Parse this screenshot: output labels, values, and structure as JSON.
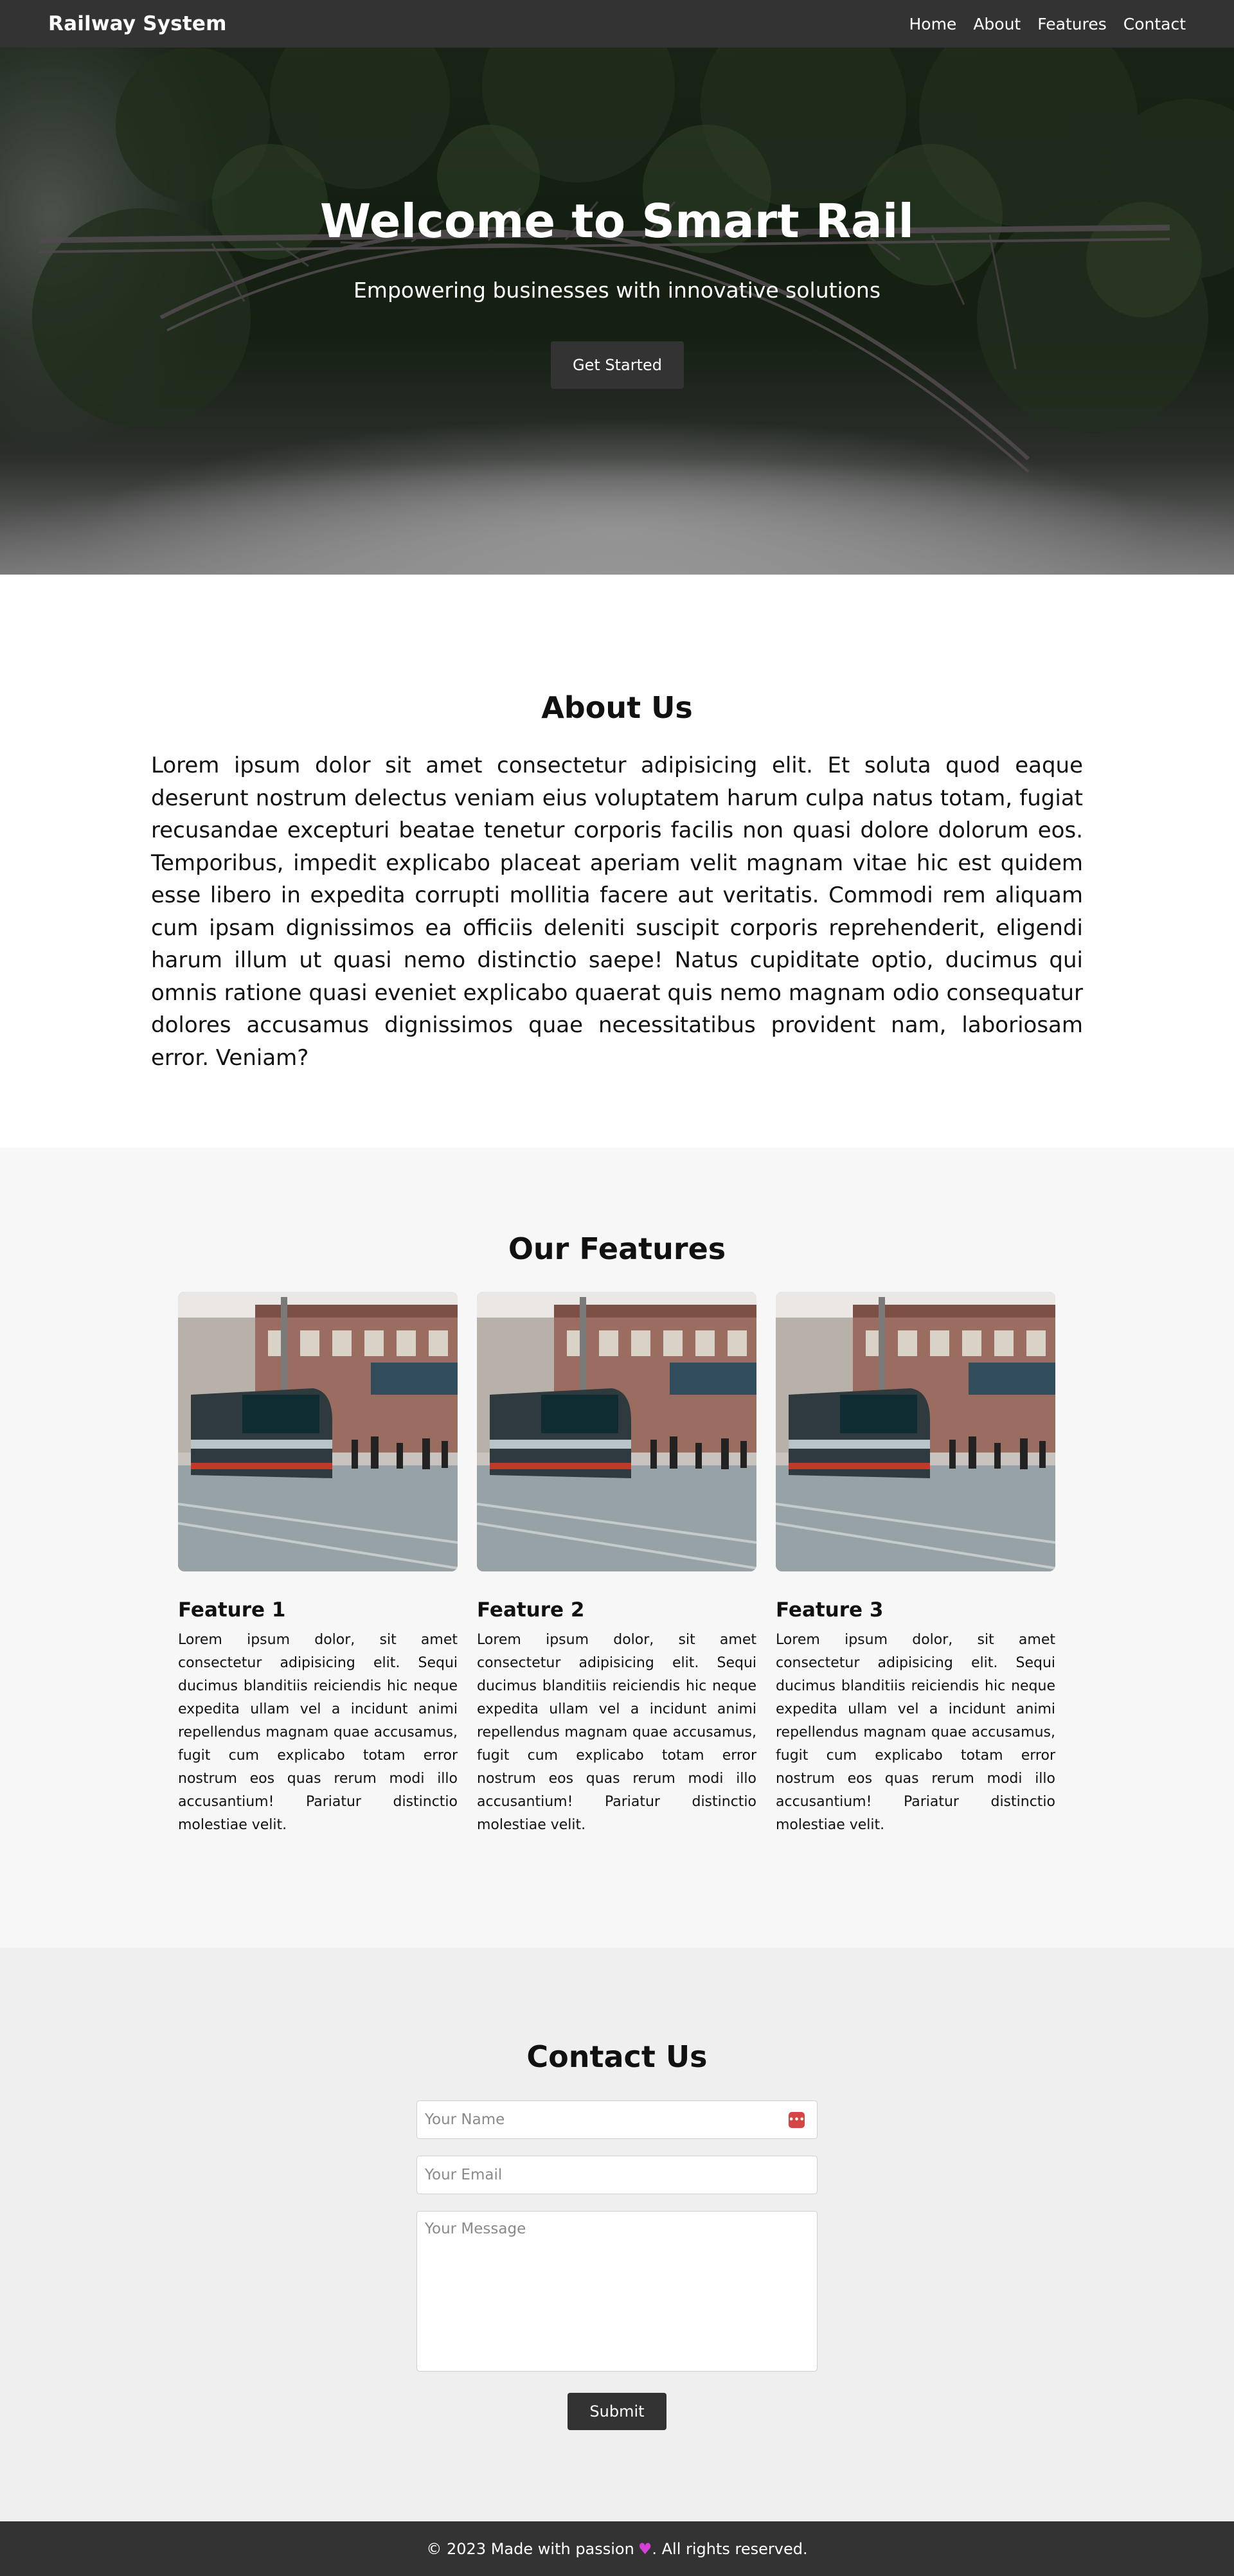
{
  "navbar": {
    "brand": "Railway System",
    "links": [
      "Home",
      "About",
      "Features",
      "Contact"
    ]
  },
  "hero": {
    "title": "Welcome to Smart Rail",
    "subtitle": "Empowering businesses with innovative solutions",
    "cta_label": "Get Started"
  },
  "about": {
    "title": "About Us",
    "text": "Lorem ipsum dolor sit amet consectetur adipisicing elit. Et soluta quod eaque deserunt nostrum delectus veniam eius voluptatem harum culpa natus totam, fugiat recusandae excepturi beatae tenetur corporis facilis non quasi dolore dolorum eos. Temporibus, impedit explicabo placeat aperiam velit magnam vitae hic est quidem esse libero in expedita corrupti mollitia facere aut veritatis. Commodi rem aliquam cum ipsam dignissimos ea officiis deleniti suscipit corporis reprehenderit, eligendi harum illum ut quasi nemo distinctio saepe! Natus cupiditate optio, ducimus qui omnis ratione quasi eveniet explicabo quaerat quis nemo magnam odio consequatur dolores accusamus dignissimos quae necessitatibus provident nam, laboriosam error. Veniam?"
  },
  "features": {
    "title": "Our Features",
    "items": [
      {
        "title": "Feature 1",
        "desc": "Lorem ipsum dolor, sit amet consectetur adipisicing elit. Sequi ducimus blanditiis reiciendis hic neque expedita ullam vel a incidunt animi repellendus magnam quae accusamus, fugit cum explicabo totam error nostrum eos quas rerum modi illo accusantium! Pariatur distinctio molestiae velit."
      },
      {
        "title": "Feature 2",
        "desc": "Lorem ipsum dolor, sit amet consectetur adipisicing elit. Sequi ducimus blanditiis reiciendis hic neque expedita ullam vel a incidunt animi repellendus magnam quae accusamus, fugit cum explicabo totam error nostrum eos quas rerum modi illo accusantium! Pariatur distinctio molestiae velit."
      },
      {
        "title": "Feature 3",
        "desc": "Lorem ipsum dolor, sit amet consectetur adipisicing elit. Sequi ducimus blanditiis reiciendis hic neque expedita ullam vel a incidunt animi repellendus magnam quae accusamus, fugit cum explicabo totam error nostrum eos quas rerum modi illo accusantium! Pariatur distinctio molestiae velit."
      }
    ]
  },
  "contact": {
    "title": "Contact Us",
    "name_placeholder": "Your Name",
    "email_placeholder": "Your Email",
    "message_placeholder": "Your Message",
    "submit_label": "Submit"
  },
  "footer": {
    "text_before": "© 2023 Made with passion",
    "heart": "♥",
    "text_after": ". All rights reserved."
  },
  "icons": {
    "autofill": "password-manager-icon",
    "heart": "heart-icon"
  },
  "colors": {
    "dark": "#333333",
    "features_bg": "#f7f7f7",
    "contact_bg": "#efefef",
    "heart": "#d63fd6",
    "autofill": "#d64545"
  }
}
